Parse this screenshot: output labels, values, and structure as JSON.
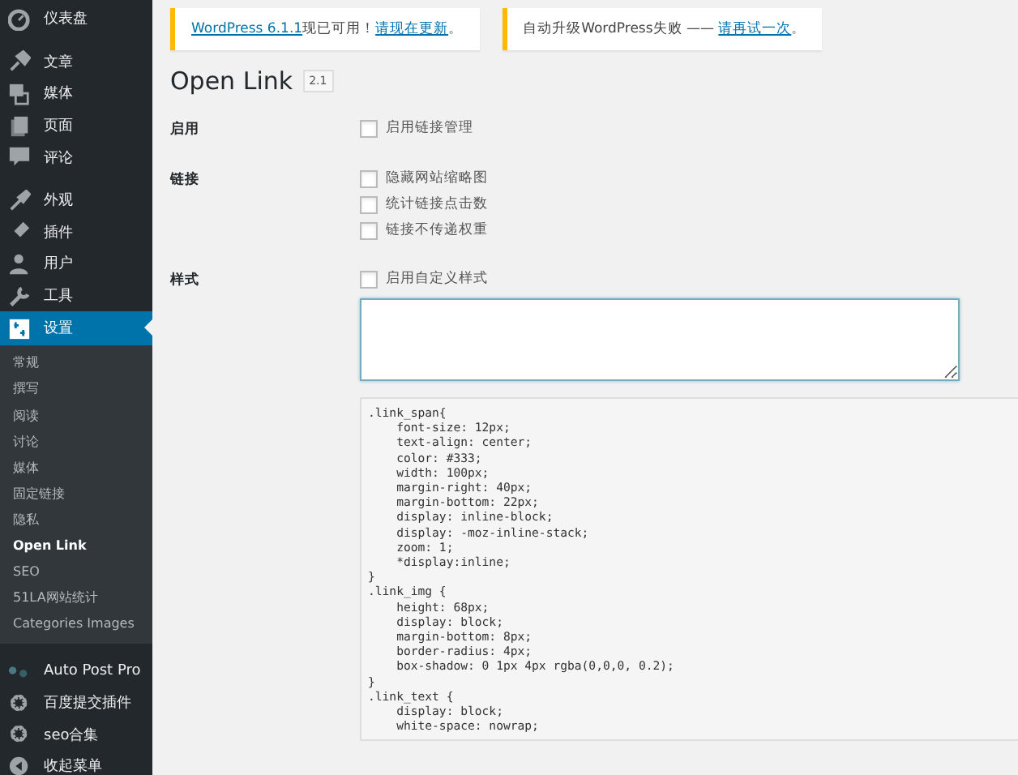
{
  "sidebar": {
    "menu": [
      {
        "label": "仪表盘",
        "kind": "dashboard",
        "selected": false
      },
      {
        "label": "文章",
        "kind": "pin",
        "selected": false
      },
      {
        "label": "媒体",
        "kind": "media",
        "selected": false
      },
      {
        "label": "页面",
        "kind": "page",
        "selected": false
      },
      {
        "label": "评论",
        "kind": "comment",
        "selected": false
      },
      {
        "label": "外观",
        "kind": "brush",
        "selected": false
      },
      {
        "label": "插件",
        "kind": "plug",
        "selected": false
      },
      {
        "label": "用户",
        "kind": "user",
        "selected": false
      },
      {
        "label": "工具",
        "kind": "wrench",
        "selected": false
      },
      {
        "label": "设置",
        "kind": "settings",
        "selected": true,
        "children": [
          {
            "label": "常规",
            "selected": false
          },
          {
            "label": "撰写",
            "selected": false
          },
          {
            "label": "阅读",
            "selected": false
          },
          {
            "label": "讨论",
            "selected": false
          },
          {
            "label": "媒体",
            "selected": false
          },
          {
            "label": "固定链接",
            "selected": false
          },
          {
            "label": "隐私",
            "selected": false
          },
          {
            "label": "Open Link",
            "selected": true
          },
          {
            "label": "SEO",
            "selected": false
          },
          {
            "label": "51LA网站统计",
            "selected": false
          },
          {
            "label": "Categories Images",
            "selected": false
          }
        ]
      },
      {
        "label": "Auto Post Pro",
        "kind": "dots",
        "selected": false
      },
      {
        "label": "百度提交插件",
        "kind": "gear",
        "selected": false
      },
      {
        "label": "seo合集",
        "kind": "gear",
        "selected": false
      },
      {
        "label": "收起菜单",
        "kind": "collapse",
        "selected": false
      }
    ]
  },
  "notices": [
    {
      "parts": [
        {
          "text": "WordPress 6.1.1",
          "link": true
        },
        {
          "text": "现已可用！",
          "link": false
        },
        {
          "text": "请现在更新",
          "link": true
        },
        {
          "text": "。",
          "link": false
        }
      ]
    },
    {
      "parts": [
        {
          "text": "自动升级WordPress失败 —— ",
          "link": false
        },
        {
          "text": "请再试一次",
          "link": true
        },
        {
          "text": "。",
          "link": false
        }
      ]
    }
  ],
  "page": {
    "title": "Open Link",
    "version": "2.1"
  },
  "settings": [
    {
      "label": "启用",
      "options": [
        {
          "label": "启用链接管理",
          "checked": false
        }
      ]
    },
    {
      "label": "链接",
      "options": [
        {
          "label": "隐藏网站缩略图",
          "checked": false
        },
        {
          "label": "统计链接点击数",
          "checked": false
        },
        {
          "label": "链接不传递权重",
          "checked": false
        }
      ]
    },
    {
      "label": "样式",
      "options": [
        {
          "label": "启用自定义样式",
          "checked": false
        }
      ],
      "textarea": true,
      "code": [
        ".link_span{",
        "    font-size: 12px;",
        "    text-align: center;",
        "    color: #333;",
        "    width: 100px;",
        "    margin-right: 40px;",
        "    margin-bottom: 22px;",
        "    display: inline-block;",
        "    display: -moz-inline-stack;",
        "    zoom: 1;",
        "    *display:inline;",
        "}",
        ".link_img {",
        "    height: 68px;",
        "    display: block;",
        "    margin-bottom: 8px;",
        "    border-radius: 4px;",
        "    box-shadow: 0 1px 4px rgba(0,0,0, 0.2);",
        "}",
        ".link_text {",
        "    display: block;",
        "    white-space: nowrap;"
      ]
    }
  ]
}
